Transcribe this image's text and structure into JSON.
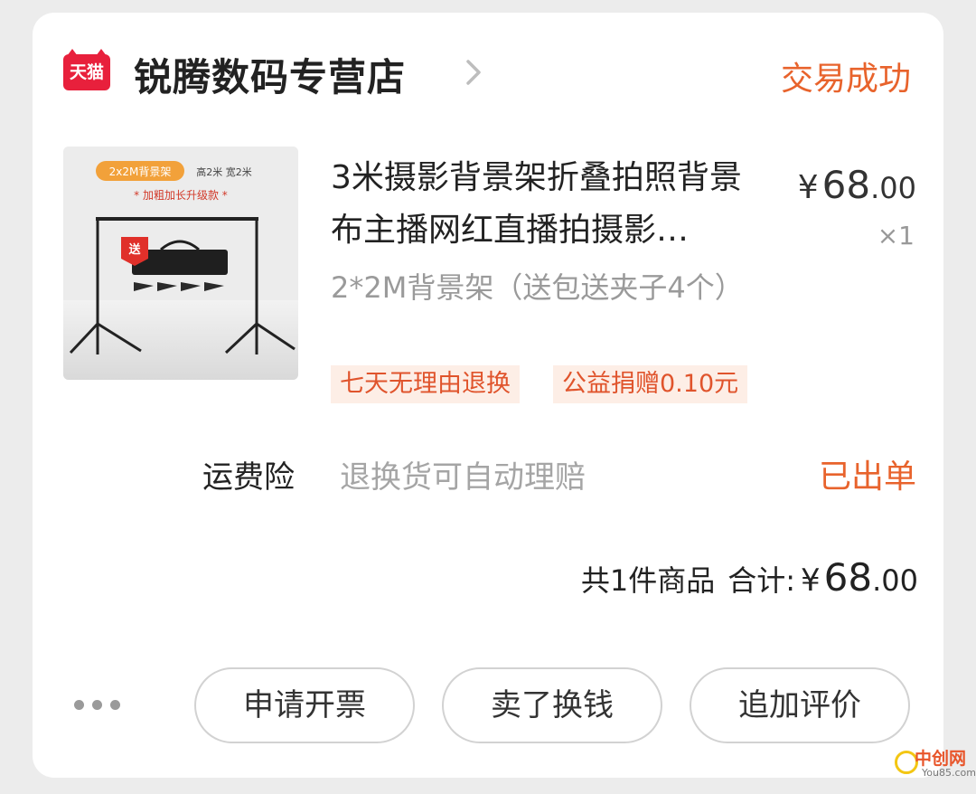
{
  "header": {
    "platform_badge": "天猫",
    "store_name": "锐腾数码专营店",
    "order_status": "交易成功"
  },
  "product": {
    "thumbnail": {
      "spec_badge": "2x2M背景架",
      "spec_size": "高2米  宽2米",
      "upgrade_text": "* 加粗加长升级款 *",
      "gift_label": "送"
    },
    "title": "3米摄影背景架折叠拍照背景布主播网红直播拍摄影…",
    "price_symbol": "¥",
    "price_int": "68",
    "price_dec": ".00",
    "quantity": "×1",
    "sku": "2*2M背景架（送包送夹子4个）",
    "tags": [
      "七天无理由退换",
      "公益捐赠0.10元"
    ]
  },
  "insurance": {
    "label": "运费险",
    "description": "退换货可自动理赔",
    "status": "已出单"
  },
  "total": {
    "count_text": "共1件商品",
    "sum_label": "合计:",
    "price_symbol": "¥",
    "price_int": "68",
    "price_dec": ".00"
  },
  "actions": {
    "more_icon": "more-dots-icon",
    "buttons": [
      "申请开票",
      "卖了换钱",
      "追加评价"
    ]
  },
  "watermark": {
    "cn": "中创网",
    "en": "You85.com"
  },
  "colors": {
    "accent_orange": "#e8632c",
    "tmall_red": "#e8203c",
    "tag_bg": "#fdeee6",
    "tag_text": "#e0542c"
  }
}
